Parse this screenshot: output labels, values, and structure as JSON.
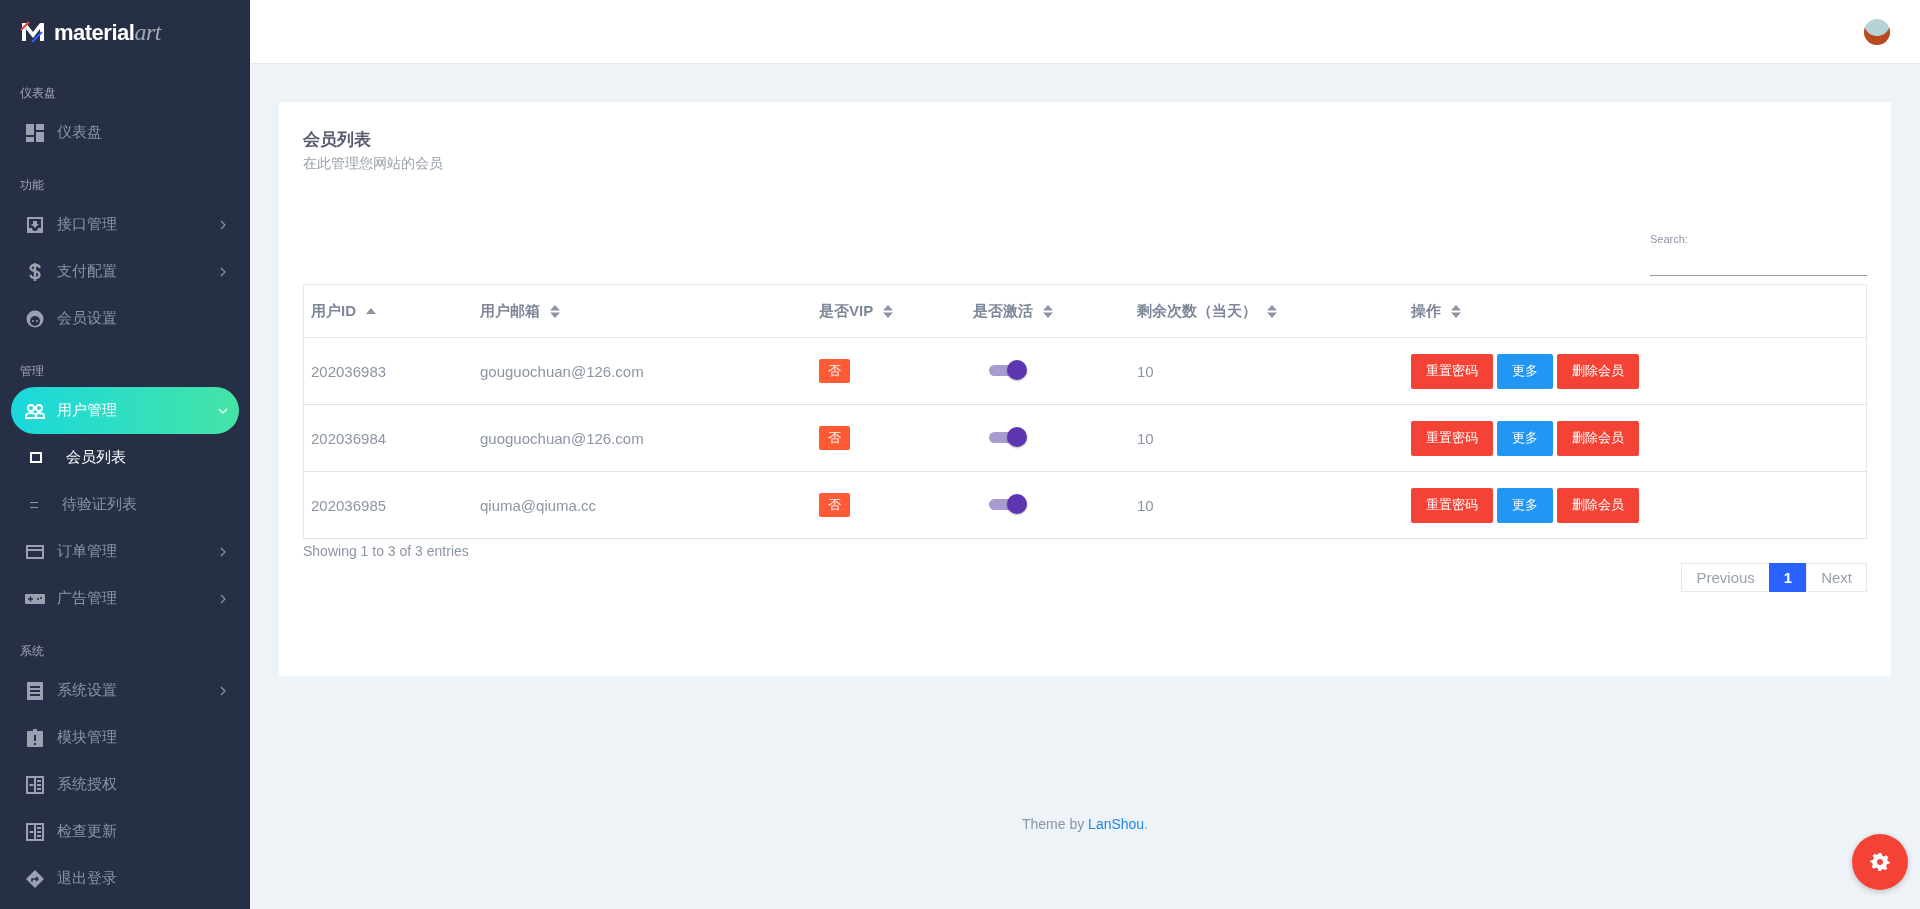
{
  "logo": {
    "main": "material",
    "accent": "art"
  },
  "sidebar": {
    "sections": [
      {
        "title": "仪表盘",
        "items": [
          {
            "label": "仪表盘",
            "has_submenu": false,
            "selected": false
          }
        ]
      },
      {
        "title": "功能",
        "items": [
          {
            "label": "接口管理",
            "has_submenu": true,
            "expanded": false,
            "selected": false
          },
          {
            "label": "支付配置",
            "has_submenu": true,
            "expanded": false,
            "selected": false
          },
          {
            "label": "会员设置",
            "has_submenu": false,
            "selected": false
          }
        ]
      },
      {
        "title": "管理",
        "items": [
          {
            "label": "用户管理",
            "has_submenu": true,
            "expanded": true,
            "selected": true,
            "children": [
              {
                "label": "会员列表",
                "selected": true
              },
              {
                "label": "待验证列表",
                "selected": false
              }
            ]
          },
          {
            "label": "订单管理",
            "has_submenu": true,
            "expanded": false,
            "selected": false
          },
          {
            "label": "广告管理",
            "has_submenu": true,
            "expanded": false,
            "selected": false
          }
        ]
      },
      {
        "title": "系统",
        "items": [
          {
            "label": "系统设置",
            "has_submenu": true,
            "expanded": false,
            "selected": false
          },
          {
            "label": "模块管理",
            "has_submenu": false,
            "selected": false
          },
          {
            "label": "系统授权",
            "has_submenu": false,
            "selected": false
          },
          {
            "label": "检查更新",
            "has_submenu": false,
            "selected": false
          },
          {
            "label": "退出登录",
            "has_submenu": false,
            "selected": false
          }
        ]
      }
    ]
  },
  "card": {
    "title": "会员列表",
    "subtitle": "在此管理您网站的会员"
  },
  "search": {
    "label": "Search:"
  },
  "table": {
    "columns": [
      {
        "label": "用户ID",
        "sorted_ascending": true
      },
      {
        "label": "用户邮箱",
        "sorted_ascending": false
      },
      {
        "label": "是否VIP",
        "sorted_ascending": false
      },
      {
        "label": "是否激活",
        "sorted_ascending": false
      },
      {
        "label": "剩余次数（当天）",
        "sorted_ascending": false
      },
      {
        "label": "操作",
        "sorted_ascending": false
      }
    ],
    "rows": [
      {
        "id": "202036983",
        "email": "gouguochuan@126.com",
        "vip": "否",
        "active": true,
        "remaining": "10",
        "actions": [
          {
            "label": "重置密码",
            "kind": "danger"
          },
          {
            "label": "更多",
            "kind": "info"
          },
          {
            "label": "删除会员",
            "kind": "danger"
          }
        ]
      },
      {
        "id": "202036984",
        "email": "guoguochuan@126.com",
        "vip": "否",
        "active": true,
        "remaining": "10",
        "actions": [
          {
            "label": "重置密码",
            "kind": "danger"
          },
          {
            "label": "更多",
            "kind": "info"
          },
          {
            "label": "删除会员",
            "kind": "danger"
          }
        ]
      },
      {
        "id": "202036985",
        "email": "qiuma@qiuma.cc",
        "vip": "否",
        "active": true,
        "remaining": "10",
        "actions": [
          {
            "label": "重置密码",
            "kind": "danger"
          },
          {
            "label": "更多",
            "kind": "info"
          },
          {
            "label": "删除会员",
            "kind": "danger"
          }
        ]
      }
    ]
  },
  "info": "Showing 1 to 3 of 3 entries",
  "pagination": [
    {
      "label": "Previous",
      "selected": false,
      "disabled": true
    },
    {
      "label": "1",
      "selected": true,
      "disabled": false
    },
    {
      "label": "Next",
      "selected": false,
      "disabled": true
    }
  ],
  "footer": {
    "text": "Theme by ",
    "link": "LanShou",
    "end": "."
  }
}
